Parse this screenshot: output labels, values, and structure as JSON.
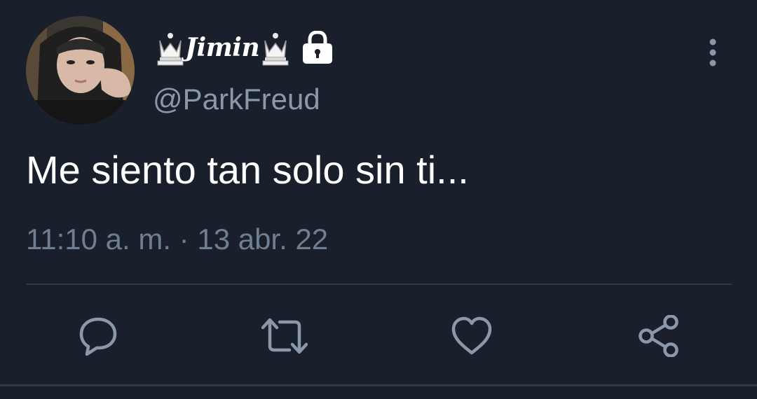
{
  "tweet": {
    "display_name": "Jimin",
    "handle": "@ParkFreud",
    "text": "Me siento tan solo sin ti...",
    "timestamp": "11:10 a. m. · 13 abr. 22",
    "protected": true
  },
  "icons": {
    "name_decoration": "chess-queen-icon",
    "protected": "lock-icon",
    "more": "more-vertical-icon",
    "reply": "reply-icon",
    "retweet": "retweet-icon",
    "like": "heart-icon",
    "share": "share-icon"
  },
  "colors": {
    "background": "#1a202b",
    "primary_text": "#ffffff",
    "secondary_text": "#8a98a9",
    "icon": "#8a98a9",
    "divider": "#2f3946"
  }
}
